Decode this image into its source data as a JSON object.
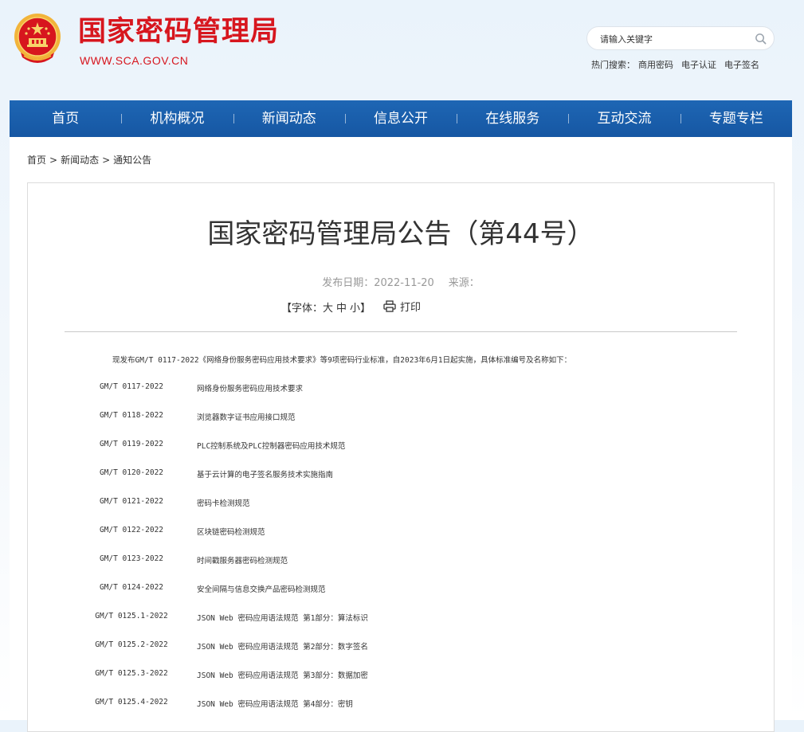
{
  "header": {
    "site_title": "国家密码管理局",
    "site_url": "WWW.SCA.GOV.CN",
    "search_placeholder": "请输入关键字",
    "hot_search_label": "热门搜索：",
    "hot_search_links": [
      "商用密码",
      "电子认证",
      "电子签名"
    ],
    "colors": {
      "brand_red": "#d7161e",
      "nav_blue": "#1a5fab"
    }
  },
  "nav": {
    "items": [
      "首页",
      "机构概况",
      "新闻动态",
      "信息公开",
      "在线服务",
      "互动交流",
      "专题专栏"
    ]
  },
  "breadcrumb": {
    "items": [
      "首页",
      "新闻动态",
      "通知公告"
    ],
    "separator": ">"
  },
  "article": {
    "title": "国家密码管理局公告（第44号）",
    "publish_date": "发布日期：2022-11-20",
    "source": "来源：",
    "font_size_label": "【字体：",
    "font_large": "大",
    "font_medium": "中",
    "font_small": "小",
    "font_close": "】",
    "print_label": "打印",
    "intro": "现发布GM/T 0117-2022《网络身份服务密码应用技术要求》等9项密码行业标准，自2023年6月1日起实施，具体标准编号及名称如下：",
    "standards": [
      {
        "code": "GM/T 0117-2022",
        "name": "网络身份服务密码应用技术要求"
      },
      {
        "code": "GM/T 0118-2022",
        "name": "浏览器数字证书应用接口规范"
      },
      {
        "code": "GM/T 0119-2022",
        "name": "PLC控制系统及PLC控制器密码应用技术规范"
      },
      {
        "code": "GM/T 0120-2022",
        "name": "基于云计算的电子签名服务技术实施指南"
      },
      {
        "code": "GM/T 0121-2022",
        "name": "密码卡检测规范"
      },
      {
        "code": "GM/T 0122-2022",
        "name": "区块链密码检测规范"
      },
      {
        "code": "GM/T 0123-2022",
        "name": "时间戳服务器密码检测规范"
      },
      {
        "code": "GM/T 0124-2022",
        "name": "安全间隔与信息交换产品密码检测规范"
      },
      {
        "code": "GM/T 0125.1-2022",
        "name": "JSON Web 密码应用语法规范 第1部分：算法标识"
      },
      {
        "code": "GM/T 0125.2-2022",
        "name": "JSON Web 密码应用语法规范 第2部分：数字签名"
      },
      {
        "code": "GM/T 0125.3-2022",
        "name": "JSON Web 密码应用语法规范 第3部分：数据加密"
      },
      {
        "code": "GM/T 0125.4-2022",
        "name": "JSON Web 密码应用语法规范 第4部分：密钥"
      }
    ]
  }
}
